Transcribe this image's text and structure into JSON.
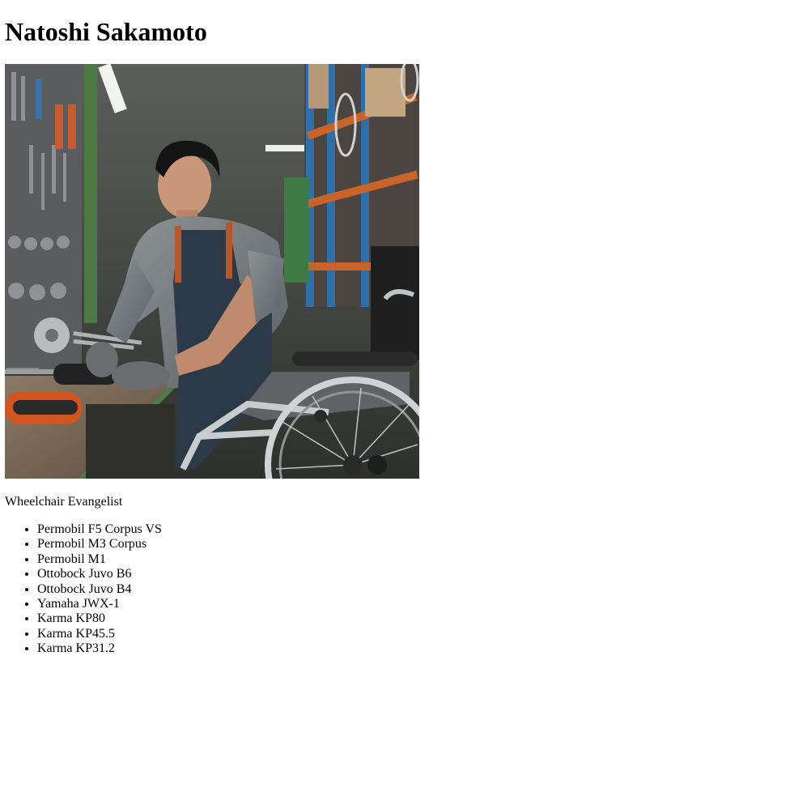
{
  "profile": {
    "name": "Natoshi Sakamoto",
    "photo_alt": "Natoshi Sakamoto working at a workbench next to a wheelchair",
    "tagline": "Wheelchair Evangelist",
    "models": [
      "Permobil F5 Corpus VS",
      "Permobil M3 Corpus",
      "Permobil M1",
      "Ottobock Juvo B6",
      "Ottobock Juvo B4",
      "Yamaha JWX-1",
      "Karma KP80",
      "Karma KP45.5",
      "Karma KP31.2"
    ]
  }
}
